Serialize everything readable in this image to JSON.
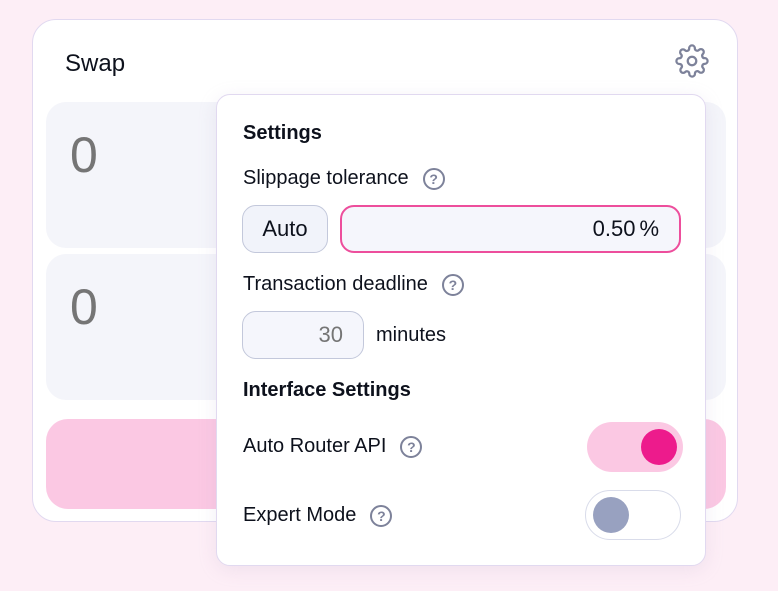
{
  "swap": {
    "title": "Swap",
    "input_amount": "0",
    "output_amount": "0"
  },
  "settings": {
    "heading": "Settings",
    "slippage_label": "Slippage tolerance",
    "auto_label": "Auto",
    "slippage_value": "0.50",
    "slippage_unit": "%",
    "deadline_label": "Transaction deadline",
    "deadline_placeholder": "30",
    "deadline_unit": "minutes",
    "interface_heading": "Interface Settings",
    "auto_router_label": "Auto Router API",
    "auto_router_enabled": true,
    "expert_mode_label": "Expert Mode",
    "expert_mode_enabled": false,
    "help_glyph": "?"
  },
  "icons": {
    "settings": "gear-icon",
    "help": "question-circle-icon"
  },
  "colors": {
    "accent": "#ed1b8c",
    "accent_light": "#fbc8e3",
    "muted": "#98a1c0",
    "background": "#fdeef6"
  }
}
